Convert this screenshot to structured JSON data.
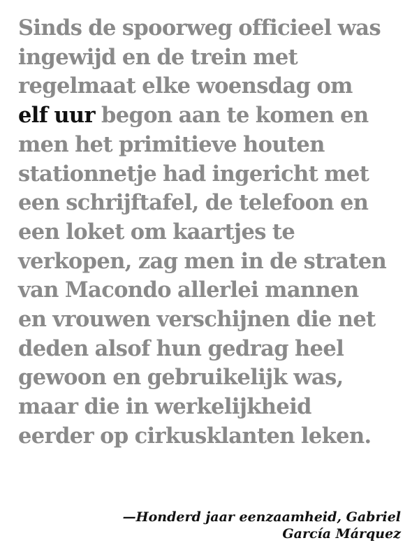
{
  "passage": {
    "lines": [
      {
        "before": "Sinds de spoorweg officieel was",
        "highlight": "",
        "after": ""
      },
      {
        "before": "ingewijd en de trein met",
        "highlight": "",
        "after": ""
      },
      {
        "before": "regelmaat elke woensdag om",
        "highlight": "",
        "after": ""
      },
      {
        "before": "",
        "highlight": "elf uur",
        "after": " begon aan te komen en"
      },
      {
        "before": "men het primitieve houten",
        "highlight": "",
        "after": ""
      },
      {
        "before": "stationnetje had ingericht met",
        "highlight": "",
        "after": ""
      },
      {
        "before": "een schrijftafel, de telefoon en",
        "highlight": "",
        "after": ""
      },
      {
        "before": "een loket om kaartjes te",
        "highlight": "",
        "after": ""
      },
      {
        "before": "verkopen, zag men in de straten",
        "highlight": "",
        "after": ""
      },
      {
        "before": "van Macondo allerlei mannen",
        "highlight": "",
        "after": ""
      },
      {
        "before": "en vrouwen verschijnen die net",
        "highlight": "",
        "after": ""
      },
      {
        "before": "deden alsof hun gedrag heel",
        "highlight": "",
        "after": ""
      },
      {
        "before": "gewoon en gebruikelijk was,",
        "highlight": "",
        "after": ""
      },
      {
        "before": "maar die in werkelijkheid",
        "highlight": "",
        "after": ""
      },
      {
        "before": "eerder op cirkusklanten leken.",
        "highlight": "",
        "after": ""
      }
    ],
    "text_color": "#8a8a8a",
    "highlight_color": "#111111"
  },
  "attribution": {
    "line1": "—Honderd jaar eenzaamheid, Gabriel",
    "line2": "García Márquez"
  }
}
